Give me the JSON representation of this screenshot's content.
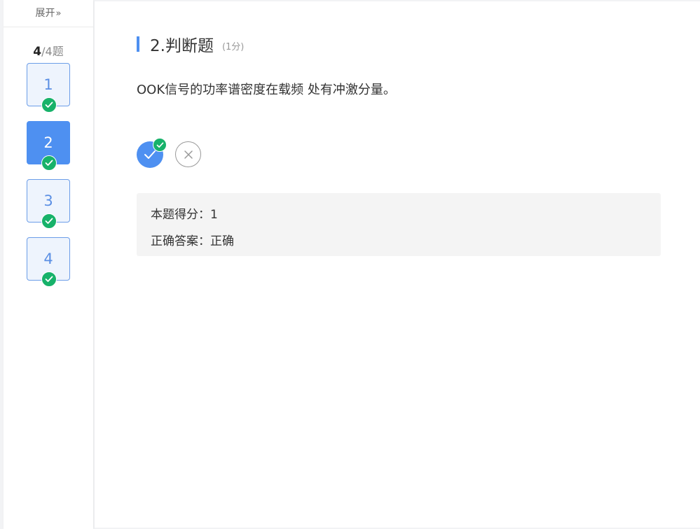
{
  "sidebar": {
    "expand_label": "展开",
    "expand_icon": "double-chevron-right-icon",
    "progress": {
      "current": "4",
      "rest": "/4题"
    },
    "questions": [
      {
        "number": "1",
        "status": "done",
        "active": false
      },
      {
        "number": "2",
        "status": "done",
        "active": true
      },
      {
        "number": "3",
        "status": "done",
        "active": false
      },
      {
        "number": "4",
        "status": "done",
        "active": false
      }
    ]
  },
  "question": {
    "title": "2.判断题",
    "score": "(1分)",
    "text": "OOK信号的功率谱密度在载频 处有冲激分量。",
    "options": [
      {
        "name": "true",
        "icon": "check-icon",
        "selected": true
      },
      {
        "name": "false",
        "icon": "close-icon",
        "selected": false
      }
    ]
  },
  "result": {
    "score_line": "本题得分：1",
    "answer_line": "正确答案：正确"
  },
  "colors": {
    "accent": "#4e90f1",
    "success": "#17b26a",
    "item_bg": "#eef4fd",
    "panel_bg": "#f4f4f4"
  }
}
